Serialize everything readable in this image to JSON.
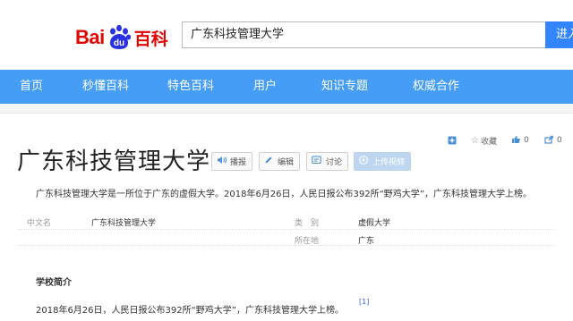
{
  "header": {
    "logo": {
      "prefix": "Bai",
      "paw_text": "du",
      "suffix": "百科"
    },
    "search": {
      "value": "广东科技管理大学",
      "button": "进入"
    }
  },
  "nav": {
    "items": [
      {
        "label": "首页"
      },
      {
        "label": "秒懂百科"
      },
      {
        "label": "特色百科"
      },
      {
        "label": "用户"
      },
      {
        "label": "知识专题"
      },
      {
        "label": "权威合作"
      }
    ]
  },
  "tools": {
    "collect_label": "收藏",
    "like_count": "0",
    "share_count": "0"
  },
  "entry": {
    "title": "广东科技管理大学",
    "buttons": {
      "voice": "播报",
      "edit": "编辑",
      "discuss": "讨论",
      "upload": "上传视频"
    },
    "summary": "广东科技管理大学是一所位于广东的虚假大学。2018年6月26日，人民日报公布392所“野鸡大学”，广东科技管理大学上榜。"
  },
  "basic_info": {
    "cn_name_key": "中文名",
    "cn_name_val": "广东科技管理大学",
    "category_key": "类　别",
    "category_val": "虚假大学",
    "location_key": "所在地",
    "location_val": "广东"
  },
  "section": {
    "title": "学校简介",
    "text": "2018年6月26日，人民日报公布392所“野鸡大学”，广东科技管理大学上榜。",
    "ref": "[1]"
  },
  "colors": {
    "brand_red": "#e10601",
    "nav_blue": "#459df5",
    "search_blue": "#3385ff",
    "paw_blue": "#2932e1"
  }
}
